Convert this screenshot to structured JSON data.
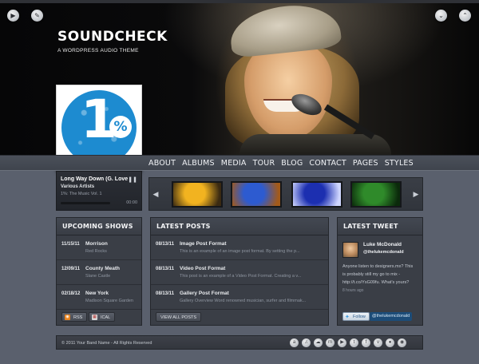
{
  "hero": {
    "title": "SOUNDCHECK",
    "tagline": "A WORDPRESS AUDIO THEME",
    "left_buttons": [
      {
        "icon": "play-icon",
        "glyph": "▶"
      },
      {
        "icon": "edit-icon",
        "glyph": "✎"
      }
    ],
    "right_buttons": [
      {
        "icon": "chevron-down-icon",
        "glyph": "⌄"
      },
      {
        "icon": "chevron-up-icon",
        "glyph": "⌃"
      }
    ]
  },
  "album": {
    "number": "1",
    "percent": "%"
  },
  "nav": {
    "items": [
      "ABOUT",
      "ALBUMS",
      "MEDIA",
      "TOUR",
      "BLOG",
      "CONTACT",
      "PAGES",
      "STYLES"
    ]
  },
  "player": {
    "track_title": "Long Way Down (G. Love",
    "artist": "Various Artists",
    "album": "1%: The Music Vol. 1",
    "time": "00:00",
    "progress": 0.0,
    "pause_glyph": "❚❚"
  },
  "strip": {
    "prev_glyph": "◀",
    "next_glyph": "▶",
    "thumbs": [
      {
        "colors": [
          "#f2b320",
          "#3a2a12"
        ]
      },
      {
        "colors": [
          "#2d5bd0",
          "#a35a1a"
        ]
      },
      {
        "colors": [
          "#1c2fb0",
          "#cfd6ff"
        ]
      },
      {
        "colors": [
          "#2f8a2a",
          "#0b2a0b"
        ]
      }
    ]
  },
  "shows": {
    "header": "UPCOMING SHOWS",
    "items": [
      {
        "date": "11/15/11",
        "title": "Morrison",
        "sub": "Red Rocks"
      },
      {
        "date": "12/09/11",
        "title": "County Meath",
        "sub": "Slane Castle"
      },
      {
        "date": "02/18/12",
        "title": "New York",
        "sub": "Madison Square Garden"
      }
    ],
    "rss_label": "RSS",
    "ical_label": "ICAL"
  },
  "posts": {
    "header": "LATEST POSTS",
    "items": [
      {
        "date": "08/13/11",
        "title": "Image Post Format",
        "sub": "This is an example of an image post format. By setting the p..."
      },
      {
        "date": "08/13/11",
        "title": "Video Post Format",
        "sub": "This post is an example of a Video Post Format. Creating a v..."
      },
      {
        "date": "08/13/11",
        "title": "Gallery Post Format",
        "sub": "Gallery Overview Word renowned musician, surfer and filmmak..."
      }
    ],
    "view_all": "VIEW ALL POSTS"
  },
  "tweet": {
    "header": "LATEST TWEET",
    "name": "Luke McDonald",
    "handle": "@thelukemcdonald",
    "text_lines": [
      "Anyone listen to designers.mx? This",
      "is probably still my go to mix -",
      "http://t.co/YsG09fu. What's yours?"
    ],
    "time": "8 hours ago",
    "follow_label": "Follow",
    "follow_handle": "@thelukemcdonald"
  },
  "footer": {
    "copyright": "© 2011 Your Band Name - All Rights Reserved",
    "socials": [
      {
        "icon": "lastfm-icon",
        "glyph": "a"
      },
      {
        "icon": "itunes-icon",
        "glyph": "♫"
      },
      {
        "icon": "soundcloud-icon",
        "glyph": "☁"
      },
      {
        "icon": "myspace-icon",
        "glyph": "m"
      },
      {
        "icon": "youtube-icon",
        "glyph": "▶"
      },
      {
        "icon": "twitter-icon",
        "glyph": "t"
      },
      {
        "icon": "facebook-icon",
        "glyph": "f"
      },
      {
        "icon": "vimeo-icon",
        "glyph": "v"
      },
      {
        "icon": "flickr-icon",
        "glyph": "●"
      },
      {
        "icon": "rss-icon",
        "glyph": "◉"
      }
    ]
  }
}
